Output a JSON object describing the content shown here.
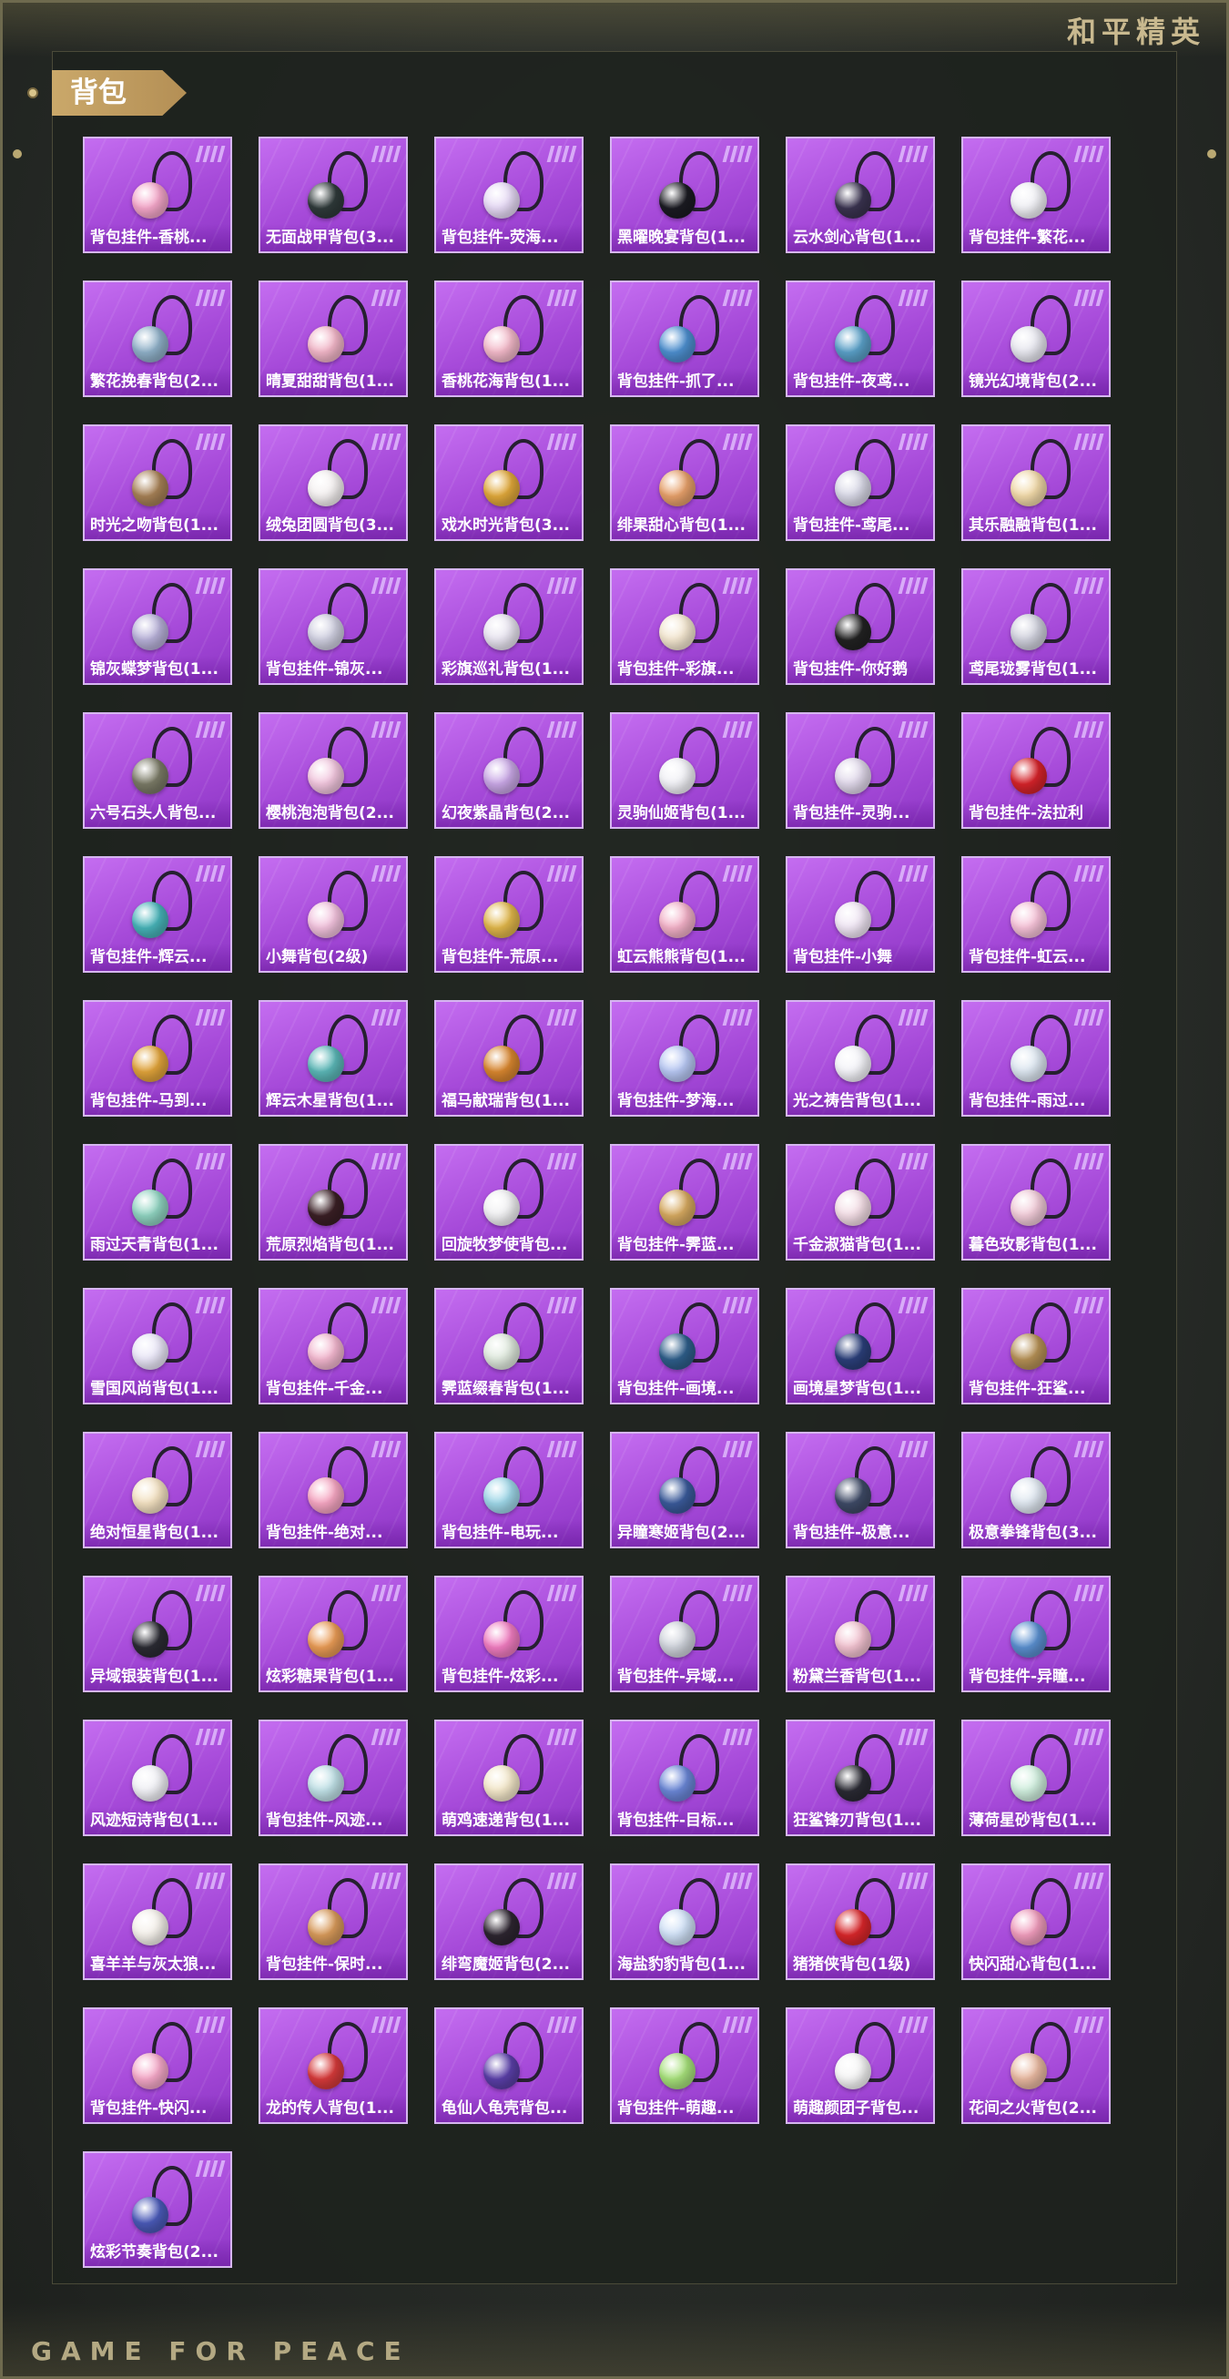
{
  "brand": {
    "corner": "和平精英",
    "footer": "GAME FOR PEACE"
  },
  "section": {
    "title": "背包"
  },
  "items": [
    {
      "label": "背包挂件-香桃...",
      "color": "#f4a6c9"
    },
    {
      "label": "无面战甲背包(3...",
      "color": "#2f3a3a"
    },
    {
      "label": "背包挂件-荧海...",
      "color": "#e6d9f5"
    },
    {
      "label": "黑曜晚宴背包(1...",
      "color": "#1b1b22"
    },
    {
      "label": "云水剑心背包(1...",
      "color": "#3a3350"
    },
    {
      "label": "背包挂件-繁花...",
      "color": "#f0f0f5"
    },
    {
      "label": "繁花挽春背包(2...",
      "color": "#8fb0c8"
    },
    {
      "label": "晴夏甜甜背包(1...",
      "color": "#f2b6c8"
    },
    {
      "label": "香桃花海背包(1...",
      "color": "#f3b9c9"
    },
    {
      "label": "背包挂件-抓了...",
      "color": "#4d8fcf"
    },
    {
      "label": "背包挂件-夜鸢...",
      "color": "#5aa0c8"
    },
    {
      "label": "镜光幻境背包(2...",
      "color": "#e7e7ef"
    },
    {
      "label": "时光之吻背包(1...",
      "color": "#a68055"
    },
    {
      "label": "绒兔团圆背包(3...",
      "color": "#f4f0f0"
    },
    {
      "label": "戏水时光背包(3...",
      "color": "#e0a83a"
    },
    {
      "label": "绯果甜心背包(1...",
      "color": "#e7a06a"
    },
    {
      "label": "背包挂件-鸢尾...",
      "color": "#d8d8e6"
    },
    {
      "label": "其乐融融背包(1...",
      "color": "#f1d9a8"
    },
    {
      "label": "锦灰蝶梦背包(1...",
      "color": "#b7b0d8"
    },
    {
      "label": "背包挂件-锦灰...",
      "color": "#cfcfe0"
    },
    {
      "label": "彩旗巡礼背包(1...",
      "color": "#e8e4f0"
    },
    {
      "label": "背包挂件-彩旗...",
      "color": "#f3e6cf"
    },
    {
      "label": "背包挂件-你好鹅",
      "color": "#222222"
    },
    {
      "label": "鸢尾珑雾背包(1...",
      "color": "#cfd0dc"
    },
    {
      "label": "六号石头人背包...",
      "color": "#7a7a66"
    },
    {
      "label": "樱桃泡泡背包(2...",
      "color": "#f2c6de"
    },
    {
      "label": "幻夜紫晶背包(2...",
      "color": "#c9a7e6"
    },
    {
      "label": "灵驹仙姬背包(1...",
      "color": "#f1f1f6"
    },
    {
      "label": "背包挂件-灵驹...",
      "color": "#e0d8ea"
    },
    {
      "label": "背包挂件-法拉利",
      "color": "#d5232a"
    },
    {
      "label": "背包挂件-辉云...",
      "color": "#47b3b8"
    },
    {
      "label": "小舞背包(2级)",
      "color": "#f2c2dd"
    },
    {
      "label": "背包挂件-荒原...",
      "color": "#e0b64a"
    },
    {
      "label": "虹云熊熊背包(1...",
      "color": "#f3b1c8"
    },
    {
      "label": "背包挂件-小舞",
      "color": "#f0e6f4"
    },
    {
      "label": "背包挂件-虹云...",
      "color": "#f6c2d8"
    },
    {
      "label": "背包挂件-马到...",
      "color": "#e0a33a"
    },
    {
      "label": "辉云木星背包(1...",
      "color": "#5bb7b7"
    },
    {
      "label": "福马献瑞背包(1...",
      "color": "#d8862f"
    },
    {
      "label": "背包挂件-梦海...",
      "color": "#b7c7f3"
    },
    {
      "label": "光之祷告背包(1...",
      "color": "#f3f3f8"
    },
    {
      "label": "背包挂件-雨过...",
      "color": "#dce6f0"
    },
    {
      "label": "雨过天青背包(1...",
      "color": "#8fd3c0"
    },
    {
      "label": "荒原烈焰背包(1...",
      "color": "#3a1f25"
    },
    {
      "label": "回旋牧梦使背包...",
      "color": "#f0f0f2"
    },
    {
      "label": "背包挂件-霁蓝...",
      "color": "#d6a960"
    },
    {
      "label": "千金淑猫背包(1...",
      "color": "#f3dde5"
    },
    {
      "label": "暮色玫影背包(1...",
      "color": "#f1cbd8"
    },
    {
      "label": "雪国风尚背包(1...",
      "color": "#e9e6f7"
    },
    {
      "label": "背包挂件-千金...",
      "color": "#f3b7cf"
    },
    {
      "label": "霁蓝缀春背包(1...",
      "color": "#dfe9dd"
    },
    {
      "label": "背包挂件-画境...",
      "color": "#2e5e8a"
    },
    {
      "label": "画境星梦背包(1...",
      "color": "#2b3f7a"
    },
    {
      "label": "背包挂件-狂鲨...",
      "color": "#b59055"
    },
    {
      "label": "绝对恒星背包(1...",
      "color": "#f3e1c1"
    },
    {
      "label": "背包挂件-绝对...",
      "color": "#f6a6c2"
    },
    {
      "label": "背包挂件-电玩...",
      "color": "#9ed7e8"
    },
    {
      "label": "异瞳寒姬背包(2...",
      "color": "#3a5a9a"
    },
    {
      "label": "背包挂件-极意...",
      "color": "#3e4a66"
    },
    {
      "label": "极意拳锋背包(3...",
      "color": "#dfe7f0"
    },
    {
      "label": "异域银装背包(1...",
      "color": "#2b2b33"
    },
    {
      "label": "炫彩糖果背包(1...",
      "color": "#e99b55"
    },
    {
      "label": "背包挂件-炫彩...",
      "color": "#f07cc0"
    },
    {
      "label": "背包挂件-异域...",
      "color": "#cfd3db"
    },
    {
      "label": "粉黛兰香背包(1...",
      "color": "#f2c2d0"
    },
    {
      "label": "背包挂件-异瞳...",
      "color": "#5a8fcf"
    },
    {
      "label": "风迹短诗背包(1...",
      "color": "#f0f0f5"
    },
    {
      "label": "背包挂件-风迹...",
      "color": "#bfe0e6"
    },
    {
      "label": "萌鸡速递背包(1...",
      "color": "#f3e7c9"
    },
    {
      "label": "背包挂件-目标...",
      "color": "#6a86d6"
    },
    {
      "label": "狂鲨锋刃背包(1...",
      "color": "#2a2a33"
    },
    {
      "label": "薄荷星砂背包(1...",
      "color": "#cfeedd"
    },
    {
      "label": "喜羊羊与灰太狼...",
      "color": "#f4f0ea"
    },
    {
      "label": "背包挂件-保时...",
      "color": "#d89a5a"
    },
    {
      "label": "绯弯魔姬背包(2...",
      "color": "#2d2530"
    },
    {
      "label": "海盐豹豹背包(1...",
      "color": "#cfe0f6"
    },
    {
      "label": "猪猪侠背包(1级)",
      "color": "#d8262a"
    },
    {
      "label": "快闪甜心背包(1...",
      "color": "#f09cbc"
    },
    {
      "label": "背包挂件-快闪...",
      "color": "#f5a8c8"
    },
    {
      "label": "龙的传人背包(1...",
      "color": "#d63a3a"
    },
    {
      "label": "龟仙人龟壳背包...",
      "color": "#5a3fa8"
    },
    {
      "label": "背包挂件-萌趣...",
      "color": "#a6e07a"
    },
    {
      "label": "萌趣颜团子背包...",
      "color": "#f5f5f5"
    },
    {
      "label": "花间之火背包(2...",
      "color": "#e8b8a0"
    },
    {
      "label": "炫彩节奏背包(2...",
      "color": "#4a5ab8"
    }
  ]
}
